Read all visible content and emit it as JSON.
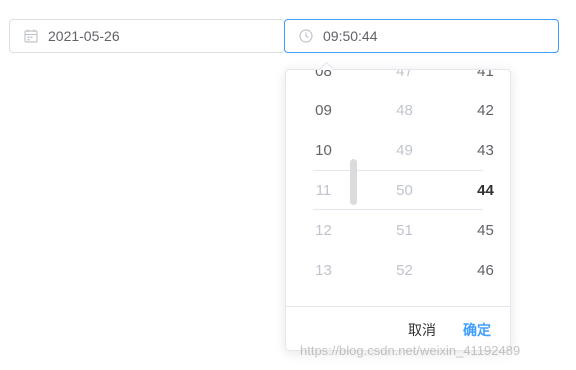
{
  "date_input": {
    "value": "2021-05-26",
    "icon": "calendar-icon"
  },
  "time_input": {
    "value": "09:50:44",
    "icon": "clock-icon"
  },
  "time_picker": {
    "hours": [
      "08",
      "09",
      "10",
      "11",
      "12",
      "13"
    ],
    "minutes": [
      "47",
      "48",
      "49",
      "50",
      "51",
      "52"
    ],
    "seconds": [
      "41",
      "42",
      "43",
      "44",
      "45",
      "46"
    ],
    "cancel_label": "取消",
    "confirm_label": "确定"
  },
  "colors": {
    "accent": "#409eff",
    "border": "#dcdfe6",
    "muted_text": "#c0c4cc"
  },
  "watermark": "https://blog.csdn.net/weixin_41192489"
}
